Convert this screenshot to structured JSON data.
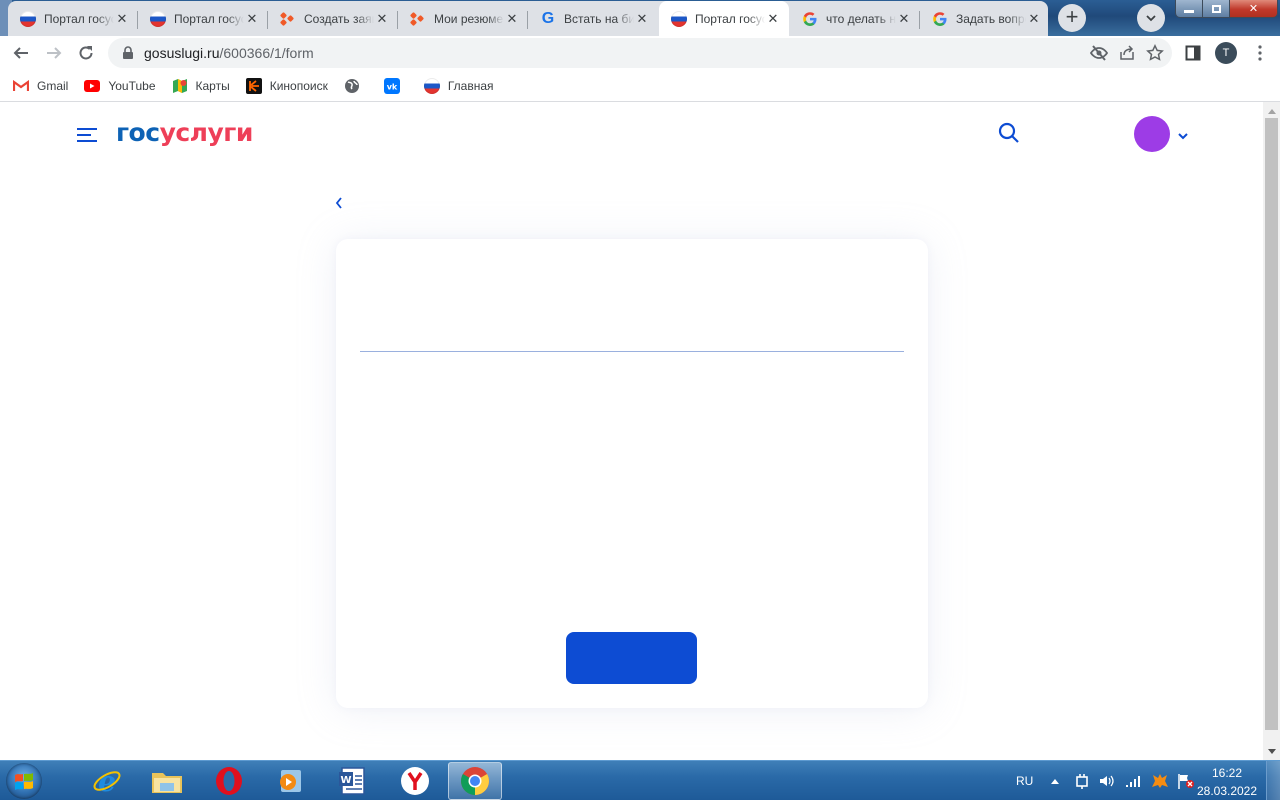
{
  "browser": {
    "tabs": [
      {
        "title": "Портал госуслуг",
        "favicon": "russia-flag-icon",
        "active": false
      },
      {
        "title": "Портал госуслуг",
        "favicon": "russia-flag-icon",
        "active": false
      },
      {
        "title": "Создать заявку",
        "favicon": "hh-icon",
        "active": false
      },
      {
        "title": "Мои резюме",
        "favicon": "hh-icon",
        "active": false
      },
      {
        "title": "Встать на биржу",
        "favicon": "g-letter-icon",
        "active": false
      },
      {
        "title": "Портал госуслуг",
        "favicon": "russia-flag-icon",
        "active": true
      },
      {
        "title": "что делать на",
        "favicon": "google-icon",
        "active": false
      },
      {
        "title": "Задать вопрос",
        "favicon": "google-icon",
        "active": false
      }
    ],
    "close_glyph": "✕",
    "new_tab_glyph": "+",
    "address": {
      "host": "gosuslugi.ru",
      "path": "/600366/1/form"
    },
    "profile_initial": "T",
    "bookmarks": [
      {
        "label": "Gmail",
        "icon": "gmail-icon"
      },
      {
        "label": "YouTube",
        "icon": "youtube-icon"
      },
      {
        "label": "Карты",
        "icon": "maps-icon"
      },
      {
        "label": "Кинопоиск",
        "icon": "kinopoisk-icon"
      },
      {
        "label": "",
        "icon": "globe-icon"
      },
      {
        "label": "",
        "icon": "vk-icon"
      },
      {
        "label": "Главная",
        "icon": "russia-flag-icon"
      }
    ]
  },
  "page": {
    "logo_part1": "гос",
    "logo_part2": "услуги",
    "avatar_color": "#9d3ce6",
    "primary_color": "#0d4cd3",
    "primary_button_label": ""
  },
  "taskbar": {
    "apps": [
      "internet-explorer",
      "file-explorer",
      "opera",
      "media-player",
      "word",
      "yandex-browser",
      "chrome"
    ],
    "language": "RU",
    "time": "16:22",
    "date": "28.03.2022"
  }
}
